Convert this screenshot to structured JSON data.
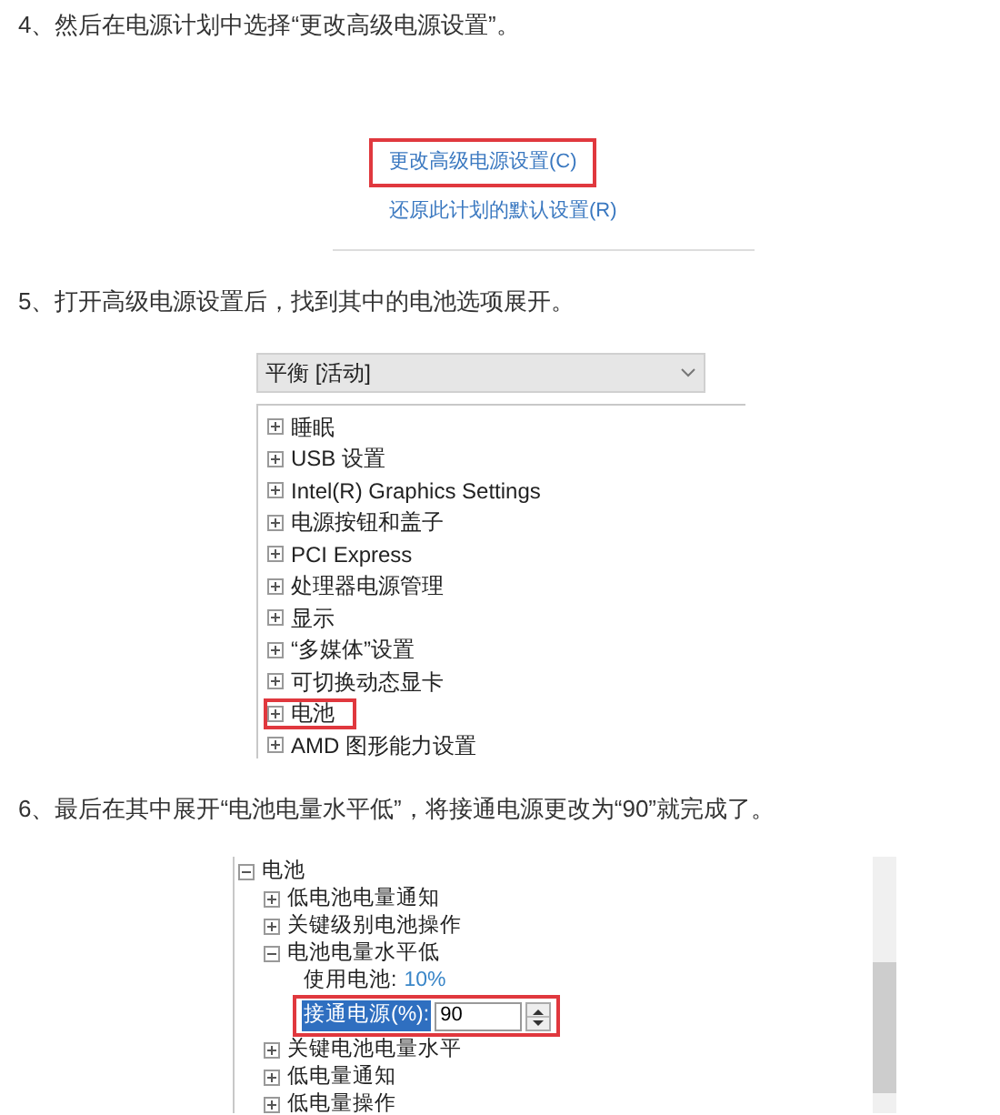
{
  "steps": [
    {
      "text": "4、然后在电源计划中选择“更改高级电源设置”。",
      "screenshot": {
        "kind": "links",
        "links": [
          {
            "label": "更改高级电源设置(C)",
            "highlighted": true
          },
          {
            "label": "还原此计划的默认设置(R)",
            "highlighted": false
          }
        ]
      }
    },
    {
      "text": "5、打开高级电源设置后，找到其中的电池选项展开。",
      "screenshot": {
        "kind": "tree",
        "dropdown": "平衡 [活动]",
        "items": [
          {
            "label": "睡眠",
            "expanded": false,
            "highlighted": false
          },
          {
            "label": "USB 设置",
            "expanded": false,
            "highlighted": false
          },
          {
            "label": "Intel(R) Graphics Settings",
            "expanded": false,
            "highlighted": false
          },
          {
            "label": "电源按钮和盖子",
            "expanded": false,
            "highlighted": false
          },
          {
            "label": "PCI Express",
            "expanded": false,
            "highlighted": false
          },
          {
            "label": "处理器电源管理",
            "expanded": false,
            "highlighted": false
          },
          {
            "label": "显示",
            "expanded": false,
            "highlighted": false
          },
          {
            "label": "“多媒体”设置",
            "expanded": false,
            "highlighted": false
          },
          {
            "label": "可切换动态显卡",
            "expanded": false,
            "highlighted": false
          },
          {
            "label": "电池",
            "expanded": false,
            "highlighted": true
          },
          {
            "label": "AMD 图形能力设置",
            "expanded": false,
            "highlighted": false
          }
        ]
      }
    },
    {
      "text": "6、最后在其中展开“电池电量水平低”，将接通电源更改为“90”就完成了。",
      "screenshot": {
        "kind": "tree",
        "items": [
          {
            "label": "电池",
            "expanded": true,
            "highlighted": false,
            "children": [
              {
                "label": "低电池电量通知",
                "expanded": false,
                "highlighted": false
              },
              {
                "label": "关键级别电池操作",
                "expanded": false,
                "highlighted": false
              },
              {
                "label": "电池电量水平低",
                "expanded": true,
                "highlighted": false,
                "children": [
                  {
                    "kind": "setting",
                    "label": "使用电池:",
                    "value": "10%"
                  },
                  {
                    "kind": "spin",
                    "label": "接通电源(%):",
                    "value": "90",
                    "highlighted": true
                  }
                ]
              },
              {
                "label": "关键电池电量水平",
                "expanded": false,
                "highlighted": false
              },
              {
                "label": "低电量通知",
                "expanded": false,
                "highlighted": false
              },
              {
                "label": "低电量操作",
                "expanded": false,
                "highlighted": false
              }
            ]
          }
        ]
      }
    }
  ]
}
